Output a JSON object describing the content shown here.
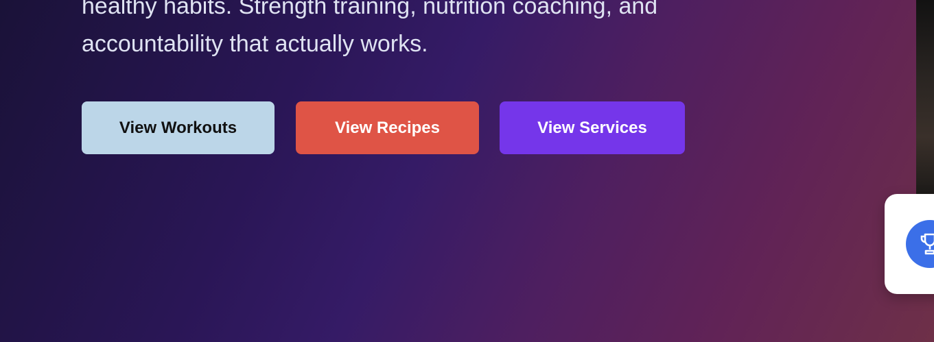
{
  "hero": {
    "line1": "healthy habits. Strength training, nutrition coaching, and",
    "line2": "accountability that actually works."
  },
  "buttons": {
    "workouts": {
      "label": "View Workouts",
      "bg": "#bcd6e8"
    },
    "recipes": {
      "label": "View Recipes",
      "bg": "#df5446"
    },
    "services": {
      "label": "View Services",
      "bg": "#7536ea"
    }
  },
  "floating_card": {
    "icon": "trophy-icon",
    "badge_color": "#3b6fe8"
  }
}
